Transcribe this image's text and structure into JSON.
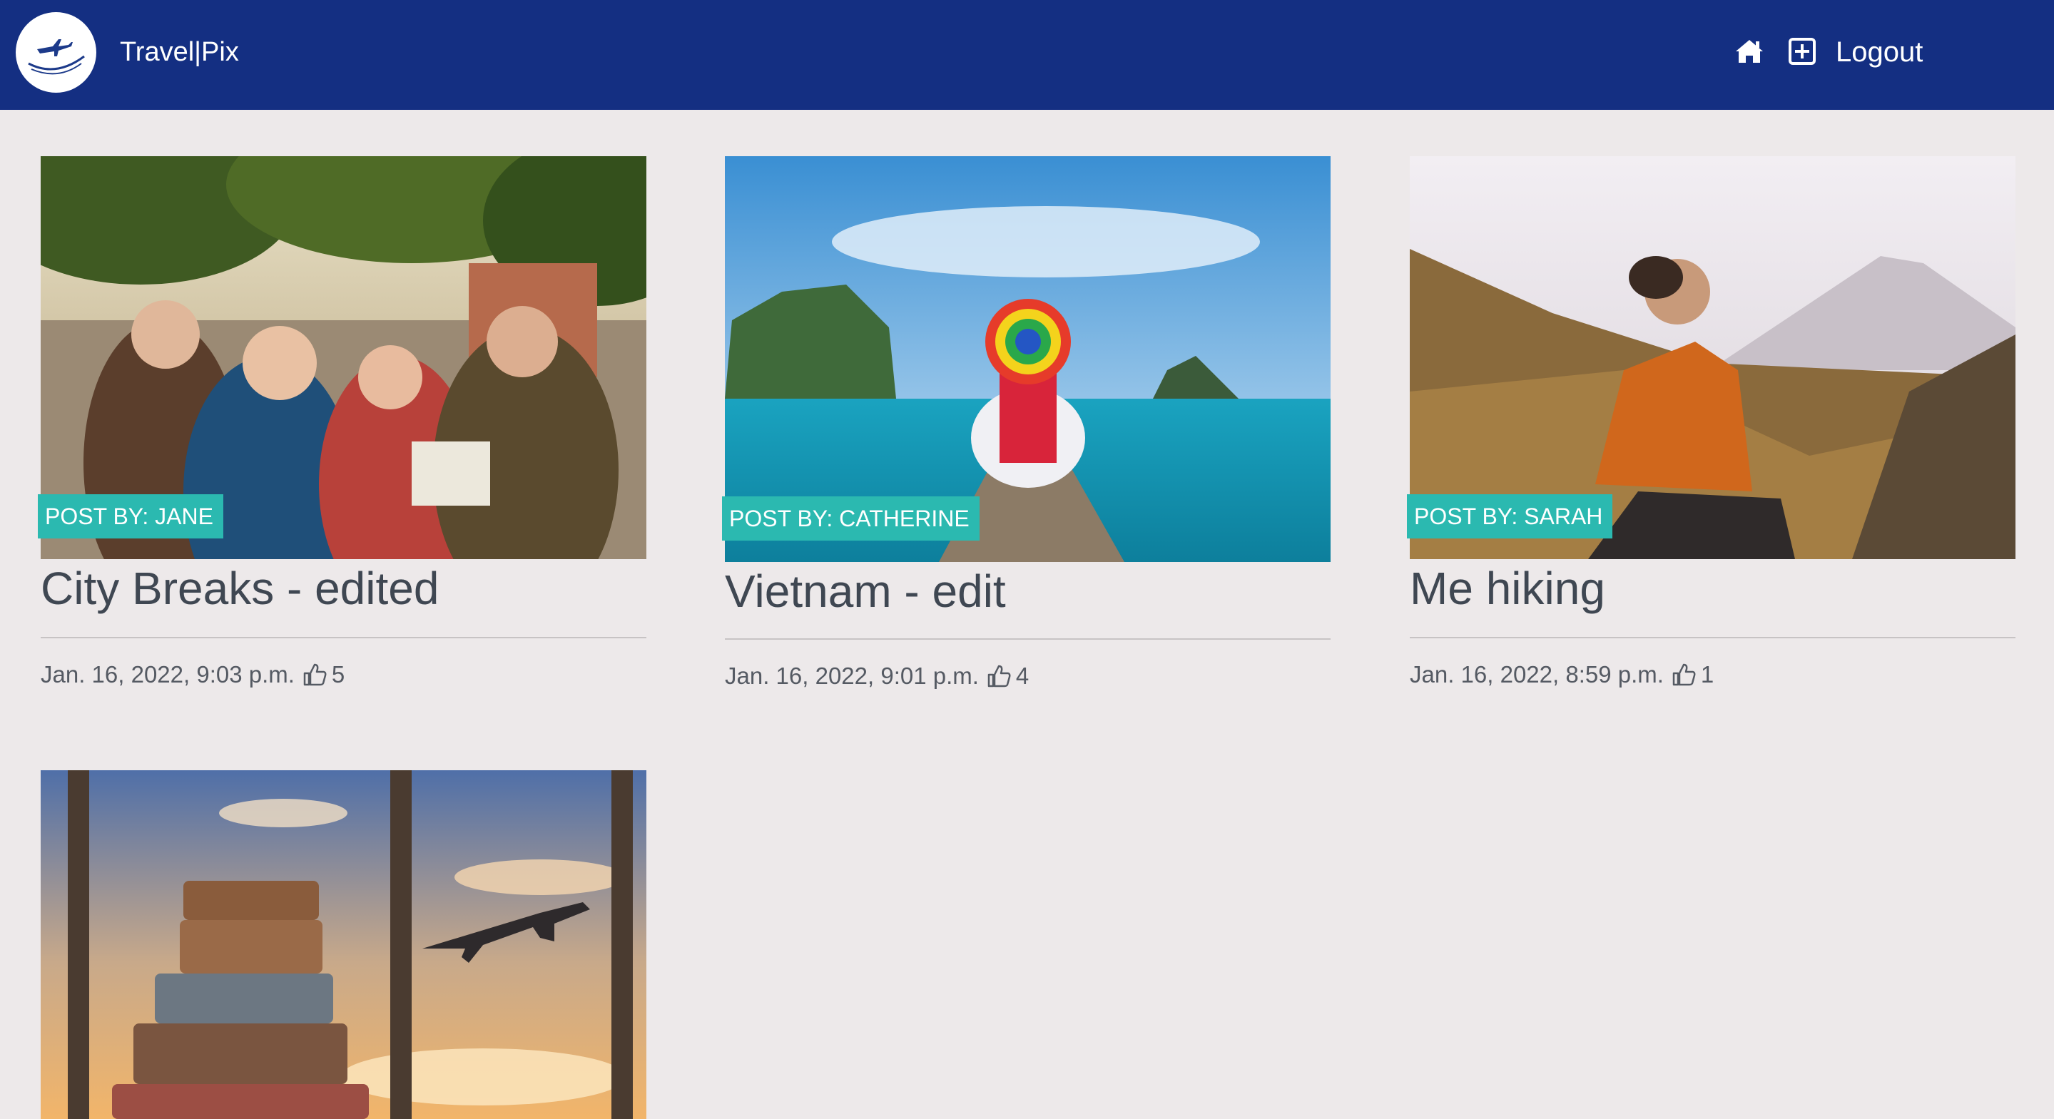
{
  "navbar": {
    "brand": "Travel|Pix",
    "logo_icon": "airplane-logo-icon",
    "home_icon": "home-icon",
    "add_icon": "plus-square-icon",
    "logout_label": "Logout",
    "background": "#142f82"
  },
  "posts": [
    {
      "badge": "POST BY: JANE",
      "title": "City Breaks - edited",
      "date": "Jan. 16, 2022, 9:03 p.m.",
      "likes": "5",
      "image": "group-of-seniors-city-photo"
    },
    {
      "badge": "POST BY: CATHERINE",
      "title": "Vietnam - edit",
      "date": "Jan. 16, 2022, 9:01 p.m.",
      "likes": "4",
      "image": "woman-on-boat-photo"
    },
    {
      "badge": "POST BY: SARAH",
      "title": "Me hiking",
      "date": "Jan. 16, 2022, 8:59 p.m.",
      "likes": "1",
      "image": "woman-hiking-mountain-photo"
    },
    {
      "image": "suitcases-airplane-window-photo"
    }
  ],
  "colors": {
    "badge": "#2bb9b0",
    "page_background": "#ede9ea",
    "title_text": "#3f4752"
  }
}
